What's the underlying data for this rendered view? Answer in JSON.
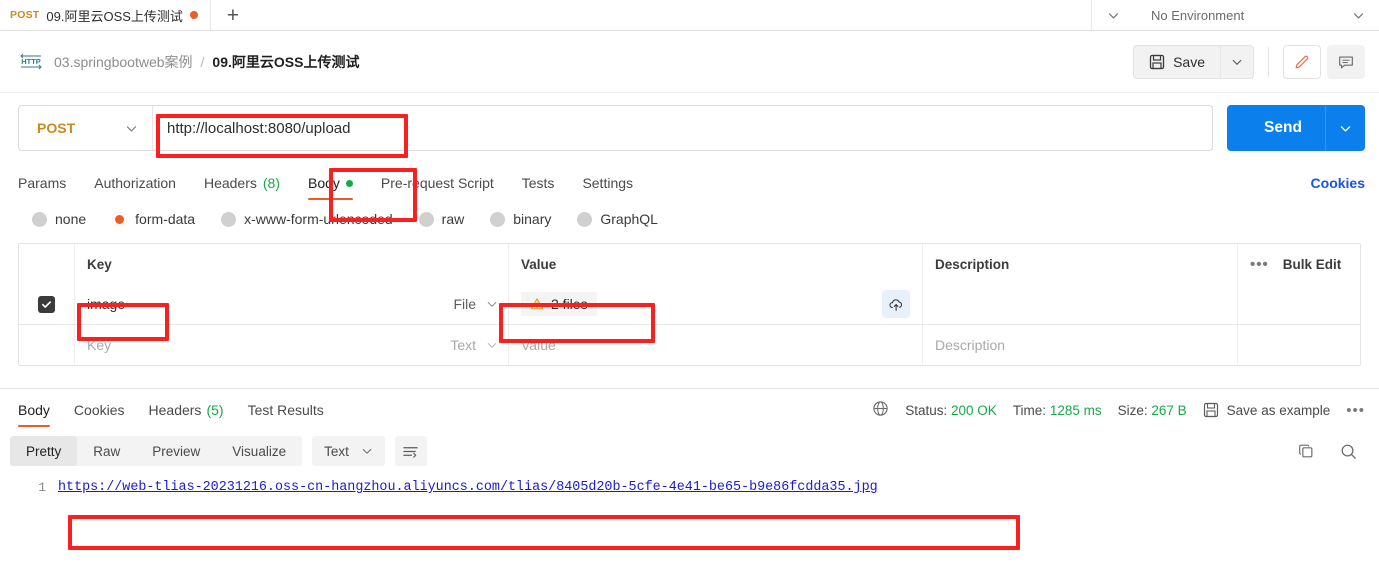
{
  "tabstrip": {
    "active_tab": {
      "method": "POST",
      "title": "09.阿里云OSS上传测试",
      "unsaved_icon": "unsaved-dot"
    },
    "new_tab_label": "+",
    "overflow_icon": "chevron-down-icon",
    "environment": {
      "label": "No Environment",
      "caret_icon": "chevron-down-icon"
    }
  },
  "breadcrumb": {
    "protocol_badge": "HTTP",
    "parent": "03.springbootweb案例",
    "separator": "/",
    "current": "09.阿里云OSS上传测试"
  },
  "actions": {
    "save_label": "Save",
    "save_icon": "floppy-disk-icon",
    "save_caret_icon": "chevron-down-icon",
    "edit_icon": "pencil-icon",
    "comment_icon": "comment-icon"
  },
  "request": {
    "method": "POST",
    "method_caret_icon": "chevron-down-icon",
    "url": "http://localhost:8080/upload",
    "send_label": "Send",
    "send_caret_icon": "chevron-down-icon"
  },
  "request_tabs": [
    {
      "label": "Params",
      "active": false
    },
    {
      "label": "Authorization",
      "active": false
    },
    {
      "label": "Headers",
      "count": "(8)",
      "active": false
    },
    {
      "label": "Body",
      "active": true,
      "indicator": "green-dot"
    },
    {
      "label": "Pre-request Script",
      "active": false
    },
    {
      "label": "Tests",
      "active": false
    },
    {
      "label": "Settings",
      "active": false
    }
  ],
  "cookies_link": "Cookies",
  "body_types": [
    {
      "label": "none",
      "selected": false
    },
    {
      "label": "form-data",
      "selected": true
    },
    {
      "label": "x-www-form-urlencoded",
      "selected": false
    },
    {
      "label": "raw",
      "selected": false
    },
    {
      "label": "binary",
      "selected": false
    },
    {
      "label": "GraphQL",
      "selected": false
    }
  ],
  "form_table": {
    "headers": {
      "key": "Key",
      "value": "Value",
      "description": "Description",
      "bulk_edit": "Bulk Edit",
      "more_icon": "ellipsis-icon"
    },
    "rows": [
      {
        "checked": true,
        "key": "image",
        "type": "File",
        "value": "2 files",
        "value_icon": "warning-triangle-icon",
        "description": "",
        "upload_icon": "cloud-upload-icon"
      },
      {
        "checked": false,
        "key_placeholder": "Key",
        "type": "Text",
        "value_placeholder": "Value",
        "description_placeholder": "Description"
      }
    ]
  },
  "response_tabs": [
    {
      "label": "Body",
      "active": true
    },
    {
      "label": "Cookies",
      "active": false
    },
    {
      "label": "Headers",
      "count": "(5)",
      "active": false
    },
    {
      "label": "Test Results",
      "active": false
    }
  ],
  "response_meta": {
    "network_icon": "globe-icon",
    "status_label": "Status:",
    "status_value": "200 OK",
    "time_label": "Time:",
    "time_value": "1285 ms",
    "size_label": "Size:",
    "size_value": "267 B",
    "save_example_icon": "floppy-disk-icon",
    "save_example_label": "Save as example",
    "more_icon": "ellipsis-icon"
  },
  "viewer_bar": {
    "tabs": [
      {
        "label": "Pretty",
        "active": true
      },
      {
        "label": "Raw",
        "active": false
      },
      {
        "label": "Preview",
        "active": false
      },
      {
        "label": "Visualize",
        "active": false
      }
    ],
    "format": "Text",
    "format_caret_icon": "chevron-down-icon",
    "wrap_icon": "wrap-lines-icon",
    "copy_icon": "copy-icon",
    "search_icon": "search-icon"
  },
  "response_body": {
    "line_number": "1",
    "line_text": "https://web-tlias-20231216.oss-cn-hangzhou.aliyuncs.com/tlias/8405d20b-5cfe-4e41-be65-b9e86fcdda35.jpg"
  },
  "colors": {
    "accent_orange": "#ef5b25",
    "send_blue": "#0b7fec",
    "status_green": "#17a84c",
    "link_blue": "#1a1ad6",
    "method_gold": "#c98a20",
    "annotation_red": "#fb2020"
  }
}
